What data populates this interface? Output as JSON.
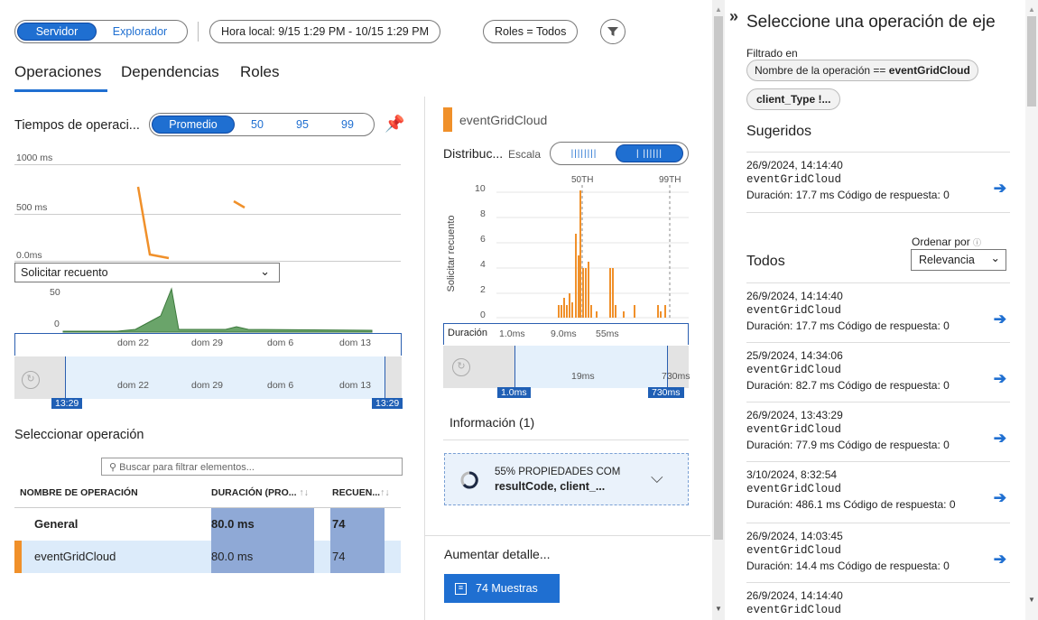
{
  "toolbar": {
    "server_label": "Servidor",
    "explorer_label": "Explorador",
    "time_filter": "Hora local: 9/15 1:29 PM - 10/15 1:29 PM",
    "roles_filter": "Roles = Todos"
  },
  "tabs": [
    "Operaciones",
    "Dependencias",
    "Roles"
  ],
  "ops_chart": {
    "title": "Tiempos de operaci...",
    "modes": [
      "Promedio",
      "50",
      "95",
      "99"
    ],
    "y_labels": [
      "1000 ms",
      "500 ms",
      "0.0ms"
    ],
    "metric_select": "Solicitar recuento",
    "count_labels": [
      "50",
      "0"
    ],
    "x_labels": [
      "dom 22",
      "dom 29",
      "dom 6",
      "dom 13"
    ],
    "range_start": "13:29",
    "range_end": "13:29"
  },
  "select_op": {
    "title": "Seleccionar operación",
    "search_placeholder": "Buscar para filtrar elementos...",
    "headers": [
      "NOMBRE DE OPERACIÓN",
      "DURACIÓN (PRO...",
      "RECUEN..."
    ],
    "rows": [
      {
        "name": "General",
        "duration": "80.0 ms",
        "count": "74"
      },
      {
        "name": "eventGridCloud",
        "duration": "80.0 ms",
        "count": "74"
      }
    ]
  },
  "dist": {
    "op_name": "eventGridCloud",
    "title": "Distribuc...",
    "scale_label": "Escala",
    "y_axis_label": "Solicitar recuento",
    "y_ticks": [
      "10",
      "8",
      "6",
      "4",
      "2",
      "0"
    ],
    "p50": "50TH",
    "p99": "99TH",
    "dur_label": "Duración",
    "dur_ticks": [
      "1.0ms",
      "9.0ms",
      "55ms"
    ],
    "brush_mid": "19ms",
    "brush_end_tick": "730ms",
    "brush_start": "1.0ms",
    "brush_end": "730ms",
    "info_title": "Información (1)",
    "insight_line1": "55% PROPIEDADES COM",
    "insight_line2": "resultCode, client_...",
    "drill_title": "Aumentar detalle...",
    "samples_btn": "74 Muestras"
  },
  "right": {
    "title": "Seleccione una operación de eje",
    "filtered_in": "Filtrado en",
    "filter1_prefix": "Nombre de la operación ==",
    "filter1_value": "eventGridCloud",
    "filter2": "client_Type !...",
    "suggested_title": "Sugeridos",
    "all_title": "Todos",
    "sort_label": "Ordenar por",
    "sort_value": "Relevancia",
    "duration_prefix": "Duración:",
    "code_prefix": "Código de respuesta:",
    "suggested": [
      {
        "date": "26/9/2024, 14:14:40",
        "name": "eventGridCloud",
        "duration": "17.7 ms",
        "code": "0"
      }
    ],
    "all": [
      {
        "date": "26/9/2024, 14:14:40",
        "name": "eventGridCloud",
        "duration": "17.7 ms",
        "code": "0"
      },
      {
        "date": "25/9/2024, 14:34:06",
        "name": "eventGridCloud",
        "duration": "82.7 ms",
        "code": "0"
      },
      {
        "date": "26/9/2024, 13:43:29",
        "name": "eventGridCloud",
        "duration": "77.9 ms",
        "code": "0"
      },
      {
        "date": "3/10/2024, 8:32:54",
        "name": "eventGridCloud",
        "duration": "486.1 ms",
        "code": "0"
      },
      {
        "date": "26/9/2024, 14:03:45",
        "name": "eventGridCloud",
        "duration": "14.4 ms",
        "code": "0"
      },
      {
        "date": "26/9/2024, 14:14:40",
        "name": "eventGridCloud",
        "duration": "",
        "code": ""
      }
    ]
  },
  "colors": {
    "accent": "#1f6fd1",
    "orange": "#f0902a",
    "green": "#6aa46a",
    "bar_blue": "#8fa9d6"
  }
}
